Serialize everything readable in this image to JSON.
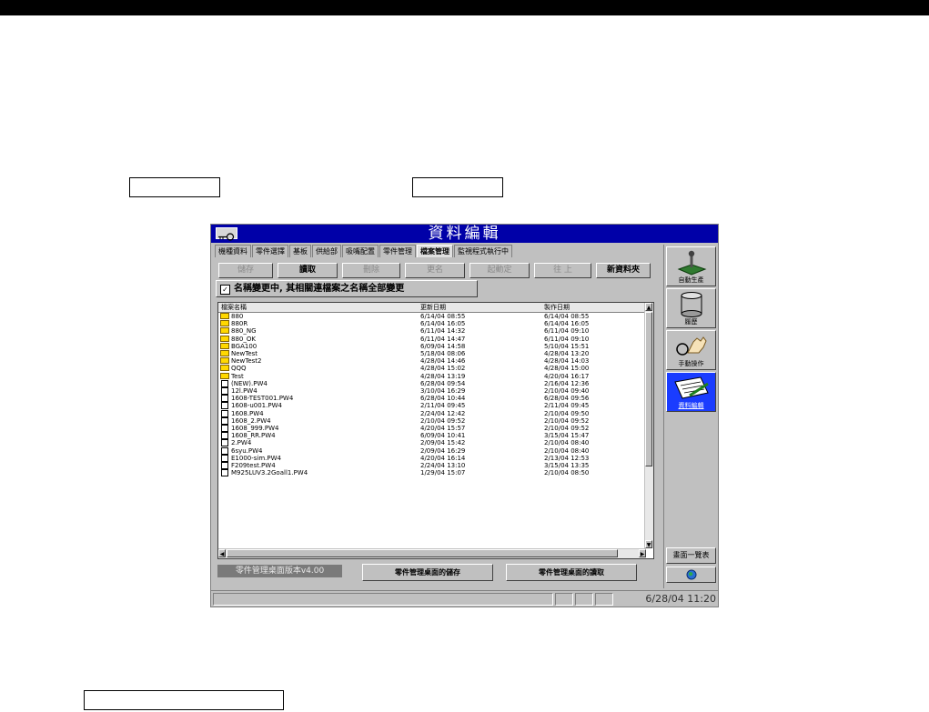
{
  "window": {
    "title": "資料編輯"
  },
  "tabs": [
    "機種資料",
    "零件選擇",
    "基板",
    "供給部",
    "吸嘴配置",
    "零件管理",
    "檔案管理",
    "監視程式執行中"
  ],
  "active_tab_index": 6,
  "toolbar": {
    "buttons": [
      {
        "label": "儲存",
        "enabled": false
      },
      {
        "label": "讀取",
        "enabled": true
      },
      {
        "label": "刪除",
        "enabled": false
      },
      {
        "label": "更名",
        "enabled": false
      },
      {
        "label": "起動定",
        "enabled": false
      },
      {
        "label": "往 上",
        "enabled": false
      },
      {
        "label": "新資料夾",
        "enabled": true
      }
    ]
  },
  "rename_option": {
    "label": "名稱變更中, 其相關連檔案之名稱全部變更",
    "checked": true,
    "mark": "✓"
  },
  "file_list": {
    "headers": [
      "檔案名稱",
      "更新日期",
      "製作日期"
    ],
    "rows": [
      {
        "type": "folder",
        "name": "880",
        "updated": "6/14/04 08:55",
        "created": "6/14/04 08:55"
      },
      {
        "type": "folder",
        "name": "880R",
        "updated": "6/14/04 16:05",
        "created": "6/14/04 16:05"
      },
      {
        "type": "folder",
        "name": "880_NG",
        "updated": "6/11/04 14:32",
        "created": "6/11/04 09:10"
      },
      {
        "type": "folder",
        "name": "880_OK",
        "updated": "6/11/04 14:47",
        "created": "6/11/04 09:10"
      },
      {
        "type": "folder",
        "name": "BGA100",
        "updated": "6/09/04 14:58",
        "created": "5/10/04 15:51"
      },
      {
        "type": "folder",
        "name": "NewTest",
        "updated": "5/18/04 08:06",
        "created": "4/28/04 13:20"
      },
      {
        "type": "folder",
        "name": "NewTest2",
        "updated": "4/28/04 14:46",
        "created": "4/28/04 14:03"
      },
      {
        "type": "folder",
        "name": "QQQ",
        "updated": "4/28/04 15:02",
        "created": "4/28/04 15:00"
      },
      {
        "type": "folder",
        "name": "Test",
        "updated": "4/28/04 13:19",
        "created": "4/20/04 16:17"
      },
      {
        "type": "file",
        "name": "(NEW).PW4",
        "updated": "6/28/04 09:54",
        "created": "2/16/04 12:36"
      },
      {
        "type": "file",
        "name": "12l.PW4",
        "updated": "3/10/04 16:29",
        "created": "2/10/04 09:40"
      },
      {
        "type": "file",
        "name": "1608-TEST001.PW4",
        "updated": "6/28/04 10:44",
        "created": "6/28/04 09:56"
      },
      {
        "type": "file",
        "name": "1608-u001.PW4",
        "updated": "2/11/04 09:45",
        "created": "2/11/04 09:45"
      },
      {
        "type": "file",
        "name": "1608.PW4",
        "updated": "2/24/04 12:42",
        "created": "2/10/04 09:50"
      },
      {
        "type": "file",
        "name": "1608_2.PW4",
        "updated": "2/10/04 09:52",
        "created": "2/10/04 09:52"
      },
      {
        "type": "file",
        "name": "1608_999.PW4",
        "updated": "4/20/04 15:57",
        "created": "2/10/04 09:52"
      },
      {
        "type": "file",
        "name": "1608_RR.PW4",
        "updated": "6/09/04 10:41",
        "created": "3/15/04 15:47"
      },
      {
        "type": "file",
        "name": "2.PW4",
        "updated": "2/09/04 15:42",
        "created": "2/10/04 08:40"
      },
      {
        "type": "file",
        "name": "6syu.PW4",
        "updated": "2/09/04 16:29",
        "created": "2/10/04 08:40"
      },
      {
        "type": "file",
        "name": "E1000-sim.PW4",
        "updated": "4/20/04 16:14",
        "created": "2/13/04 12:53"
      },
      {
        "type": "file",
        "name": "F209test.PW4",
        "updated": "2/24/04 13:10",
        "created": "3/15/04 13:35"
      },
      {
        "type": "file",
        "name": "M925LUV3.2Goall1.PW4",
        "updated": "1/29/04 15:07",
        "created": "2/10/04 08:50"
      }
    ]
  },
  "version_label": "零件管理桌面版本v4.00",
  "bottom_buttons": [
    "零件管理桌面的儲存",
    "零件管理桌面的讀取"
  ],
  "side_buttons": [
    {
      "label": "自動生產",
      "icon": "joystick-icon"
    },
    {
      "label": "履歷",
      "icon": "database-icon"
    },
    {
      "label": "手動操作",
      "icon": "hand-icon"
    },
    {
      "label": "資料編輯",
      "icon": "edit-icon",
      "active": true
    }
  ],
  "screen_list_button": "畫面一覽表",
  "status_clock": "6/28/04 11:20"
}
